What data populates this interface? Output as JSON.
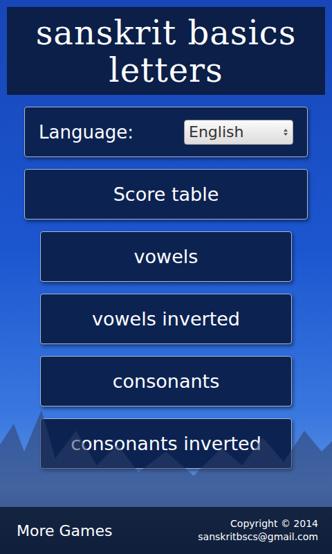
{
  "header": {
    "title_lines": [
      "sanskrit basics",
      "letters"
    ]
  },
  "language": {
    "label": "Language:",
    "value": "English"
  },
  "score_table": "Score table",
  "menu_items": [
    "vowels",
    "vowels inverted",
    "consonants",
    "consonants inverted"
  ],
  "footer": {
    "more_games": "More Games",
    "copyright": "Copyright © 2014",
    "email": "sanskritbscs@gmail.com"
  }
}
